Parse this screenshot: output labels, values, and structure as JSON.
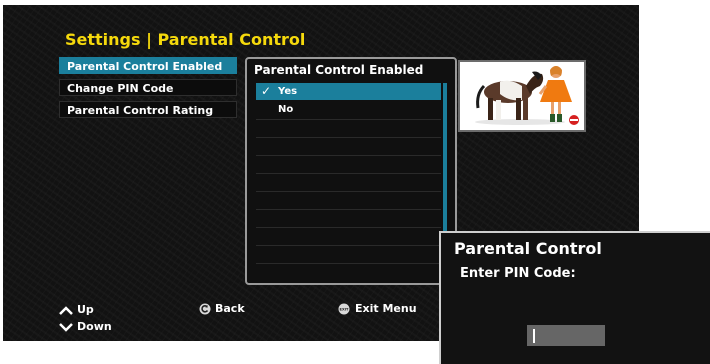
{
  "header": {
    "title": "Settings | Parental Control"
  },
  "menu": {
    "items": [
      {
        "label": "Parental Control Enabled",
        "selected": true
      },
      {
        "label": "Change PIN Code",
        "selected": false
      },
      {
        "label": "Parental Control Rating",
        "selected": false
      }
    ]
  },
  "panel": {
    "title": "Parental Control Enabled",
    "options": [
      {
        "label": "Yes",
        "checked": true,
        "check_mark": "✓"
      },
      {
        "label": "No",
        "checked": false
      }
    ]
  },
  "nav": {
    "up_label": "Up",
    "down_label": "Down",
    "back_label": "Back",
    "exit_label": "Exit Menu",
    "exit_icon_text": "EXIT"
  },
  "pin_dialog": {
    "title": "Parental Control",
    "prompt": "Enter PIN Code:",
    "value": ""
  },
  "colors": {
    "accent": "#1b7f9c",
    "title_yellow": "#f5d90c",
    "background": "#121212"
  }
}
